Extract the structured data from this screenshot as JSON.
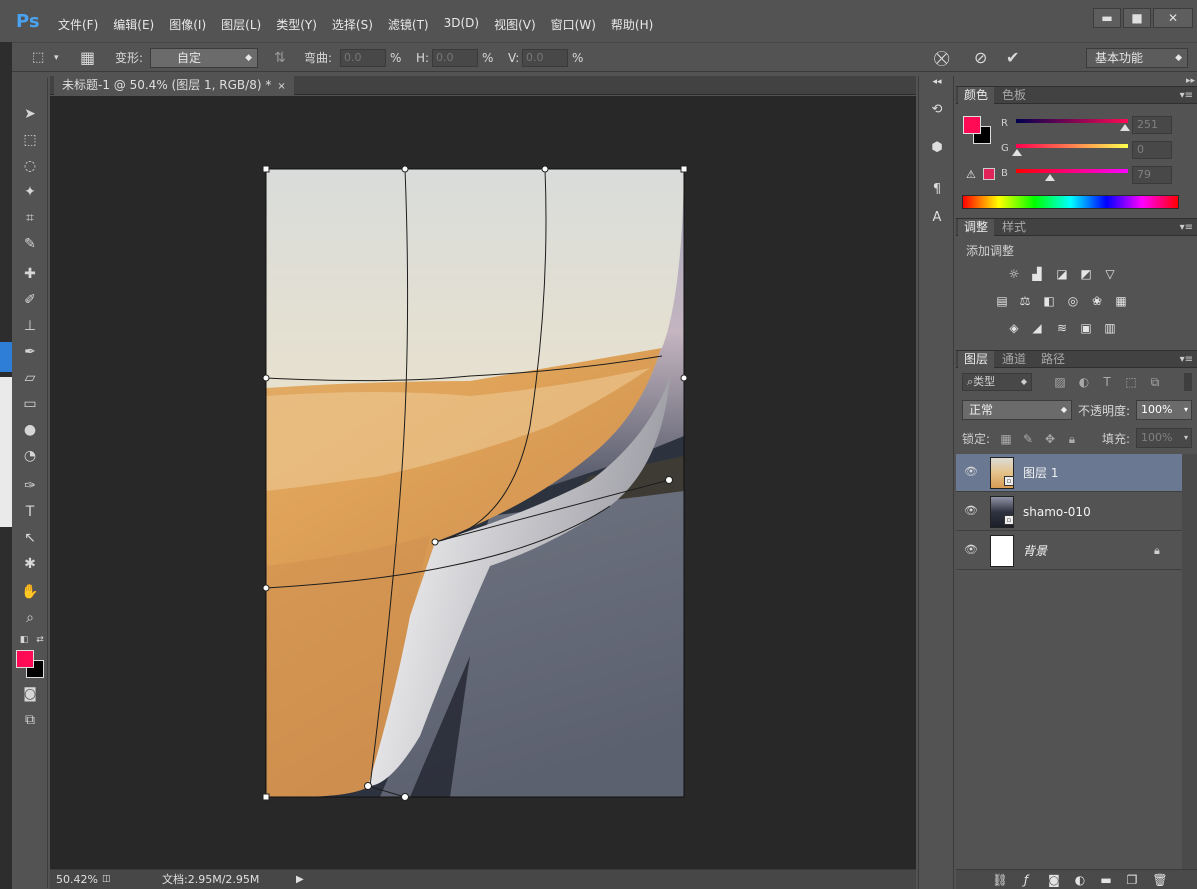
{
  "app": {
    "logo": "Ps"
  },
  "menu": [
    "文件(F)",
    "编辑(E)",
    "图像(I)",
    "图层(L)",
    "类型(Y)",
    "选择(S)",
    "滤镜(T)",
    "3D(D)",
    "视图(V)",
    "窗口(W)",
    "帮助(H)"
  ],
  "window_controls": {
    "minimize": "▬",
    "maximize": "■",
    "close": "✕"
  },
  "options": {
    "transform_label": "变形:",
    "transform_value": "自定",
    "bend_label": "弯曲:",
    "bend_value": "0.0",
    "h_label": "H:",
    "h_value": "0.0",
    "v_label": "V:",
    "v_value": "0.0",
    "percent": "%",
    "workspace": "基本功能"
  },
  "document": {
    "tab_title": "未标题-1 @ 50.4% (图层 1, RGB/8) *",
    "tab_close": "×",
    "zoom": "50.42%",
    "doc_size": "文档:2.95M/2.95M"
  },
  "colors": {
    "foreground": "#ff0a55",
    "background": "#000000"
  },
  "color_panel": {
    "tabs": [
      "颜色",
      "色板"
    ],
    "channels": [
      {
        "label": "R",
        "value": "251"
      },
      {
        "label": "G",
        "value": "0"
      },
      {
        "label": "B",
        "value": "79"
      }
    ]
  },
  "adjust_panel": {
    "tabs": [
      "调整",
      "样式"
    ],
    "add_label": "添加调整"
  },
  "layers_panel": {
    "tabs": [
      "图层",
      "通道",
      "路径"
    ],
    "filter_kind": "类型",
    "blend_mode": "正常",
    "opacity_label": "不透明度:",
    "opacity_value": "100%",
    "lock_label": "锁定:",
    "fill_label": "填充:",
    "fill_value": "100%",
    "layers": [
      {
        "name": "图层 1",
        "selected": true
      },
      {
        "name": "shamo-010",
        "selected": false
      },
      {
        "name": "背景",
        "selected": false
      }
    ]
  }
}
